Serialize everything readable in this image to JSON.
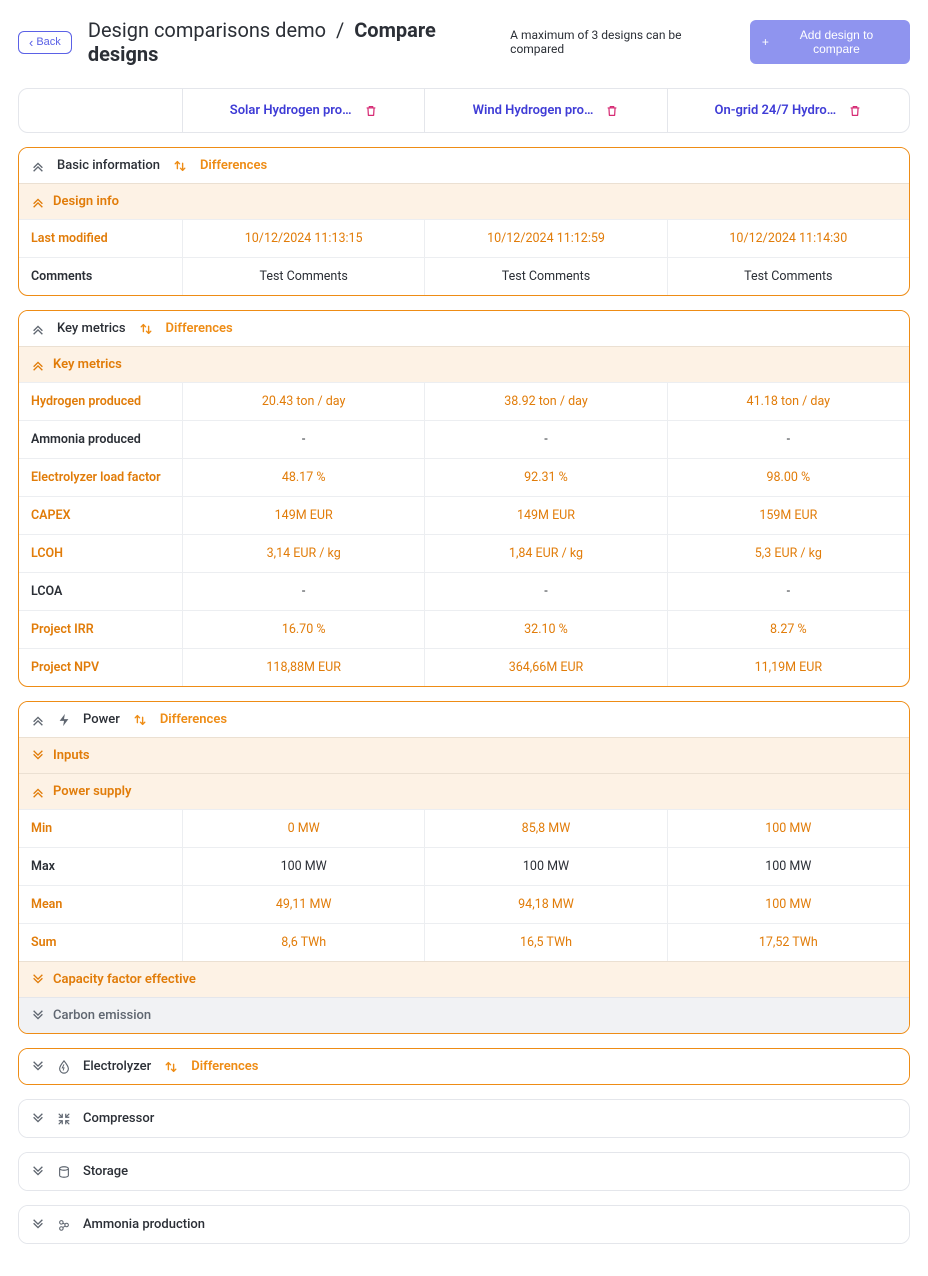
{
  "header": {
    "back_label": "Back",
    "breadcrumb_prefix": "Design comparisons demo",
    "breadcrumb_sep": "/",
    "breadcrumb_current": "Compare designs",
    "max_note": "A maximum of 3 designs can be compared",
    "add_label": "Add design to compare"
  },
  "designs": [
    {
      "name": "Solar Hydrogen pro…"
    },
    {
      "name": "Wind Hydrogen pro…"
    },
    {
      "name": "On-grid 24/7 Hydro…"
    }
  ],
  "diff_label": "Differences",
  "sections": {
    "basic": {
      "title": "Basic information",
      "design_info": "Design info",
      "rows": {
        "last_modified": {
          "label": "Last modified",
          "v": [
            "10/12/2024 11:13:15",
            "10/12/2024 11:12:59",
            "10/12/2024 11:14:30"
          ],
          "diff": true
        },
        "comments": {
          "label": "Comments",
          "v": [
            "Test Comments",
            "Test Comments",
            "Test Comments"
          ],
          "diff": false
        }
      }
    },
    "key": {
      "title": "Key metrics",
      "sub": "Key metrics",
      "rows": {
        "h2prod": {
          "label": "Hydrogen produced",
          "v": [
            "20.43 ton / day",
            "38.92 ton / day",
            "41.18 ton / day"
          ],
          "diff": true
        },
        "nh3prod": {
          "label": "Ammonia produced",
          "v": [
            "-",
            "-",
            "-"
          ],
          "diff": false
        },
        "elf": {
          "label": "Electrolyzer load factor",
          "v": [
            "48.17 %",
            "92.31 %",
            "98.00 %"
          ],
          "diff": true
        },
        "capex": {
          "label": "CAPEX",
          "v": [
            "149M EUR",
            "149M EUR",
            "159M EUR"
          ],
          "diff": true
        },
        "lcoh": {
          "label": "LCOH",
          "v": [
            "3,14 EUR / kg",
            "1,84 EUR / kg",
            "5,3 EUR / kg"
          ],
          "diff": true
        },
        "lcoa": {
          "label": "LCOA",
          "v": [
            "-",
            "-",
            "-"
          ],
          "diff": false
        },
        "irr": {
          "label": "Project IRR",
          "v": [
            "16.70 %",
            "32.10 %",
            "8.27 %"
          ],
          "diff": true
        },
        "npv": {
          "label": "Project NPV",
          "v": [
            "118,88M EUR",
            "364,66M EUR",
            "11,19M EUR"
          ],
          "diff": true
        }
      }
    },
    "power": {
      "title": "Power",
      "inputs": "Inputs",
      "supply": "Power supply",
      "rows": {
        "min": {
          "label": "Min",
          "v": [
            "0 MW",
            "85,8 MW",
            "100 MW"
          ],
          "diff": true
        },
        "max": {
          "label": "Max",
          "v": [
            "100 MW",
            "100 MW",
            "100 MW"
          ],
          "diff": false
        },
        "mean": {
          "label": "Mean",
          "v": [
            "49,11 MW",
            "94,18 MW",
            "100 MW"
          ],
          "diff": true
        },
        "sum": {
          "label": "Sum",
          "v": [
            "8,6 TWh",
            "16,5 TWh",
            "17,52 TWh"
          ],
          "diff": true
        }
      },
      "cap_factor": "Capacity factor effective",
      "carbon": "Carbon emission"
    },
    "electrolyzer": {
      "title": "Electrolyzer"
    },
    "compressor": {
      "title": "Compressor"
    },
    "storage": {
      "title": "Storage"
    },
    "ammonia": {
      "title": "Ammonia production"
    }
  }
}
